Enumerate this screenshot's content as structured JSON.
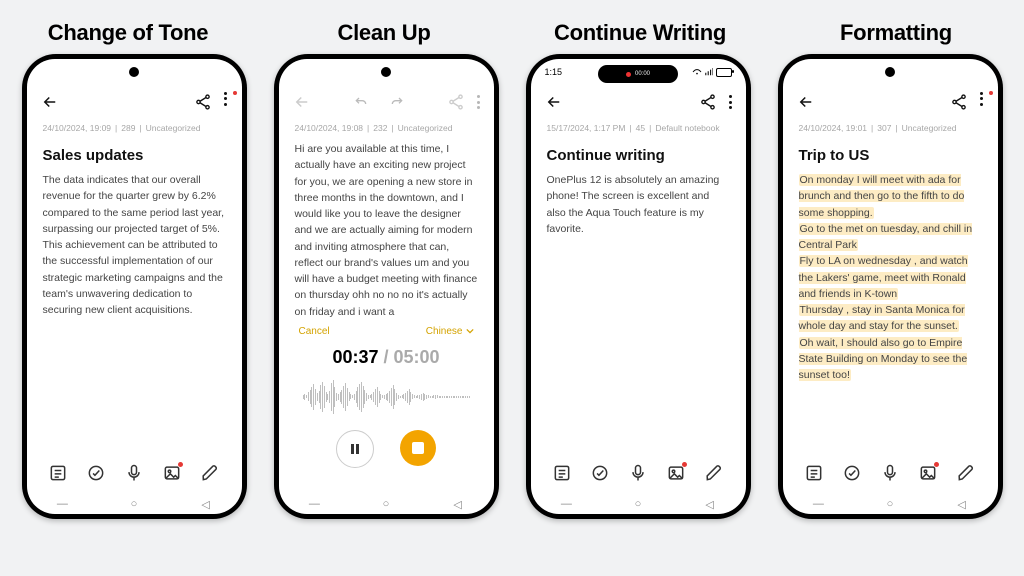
{
  "labels": [
    "Change of Tone",
    "Clean Up",
    "Continue Writing",
    "Formatting"
  ],
  "phones": [
    {
      "meta": {
        "date": "24/10/2024, 19:09",
        "count": "289",
        "category": "Uncategorized"
      },
      "title": "Sales updates",
      "body": "The data indicates that our overall revenue for the quarter grew by 6.2% compared to the same period last year, surpassing our projected target of 5%. This achievement can be attributed to the successful implementation of our strategic marketing campaigns and the team's unwavering dedication to securing new client acquisitions."
    },
    {
      "meta": {
        "date": "24/10/2024, 19:08",
        "count": "232",
        "category": "Uncategorized"
      },
      "body": "Hi are you available at this time,  I actually have an exciting new project for you,  we are opening a new store in three months in the downtown,  and I would like you to leave the designer and we are actually aiming for modern and inviting atmosphere that can,  reflect our brand's values um and you will have a budget meeting with finance on thursday ohh no no no it's actually on friday and i want a",
      "recorder": {
        "cancel": "Cancel",
        "lang": "Chinese",
        "elapsed": "00:37",
        "duration": "05:00"
      }
    },
    {
      "status": {
        "time": "1:15",
        "pill_center": "00:00"
      },
      "meta": {
        "date": "15/17/2024, 1:17 PM",
        "count": "45",
        "category": "Default notebook"
      },
      "title": "Continue writing",
      "body": "OnePlus 12 is absolutely an amazing phone! The screen is excellent and also the Aqua Touch feature is my favorite."
    },
    {
      "meta": {
        "date": "24/10/2024, 19:01",
        "count": "307",
        "category": "Uncategorized"
      },
      "title": "Trip to US",
      "body_lines": [
        "On monday I will meet with ada for brunch and then go to the fifth to do some shopping.",
        "Go to the met on tuesday, and chill in Central Park",
        "Fly to LA on wednesday ,  and watch the Lakers' game, meet with Ronald and friends in K-town",
        "Thursday , stay in Santa Monica for whole day and stay for the sunset.",
        "Oh wait, I should also go to Empire State Building on Monday to see the sunset too!"
      ]
    }
  ],
  "toolbar_icons": [
    "list-icon",
    "check-icon",
    "mic-icon",
    "image-icon",
    "pen-icon"
  ]
}
